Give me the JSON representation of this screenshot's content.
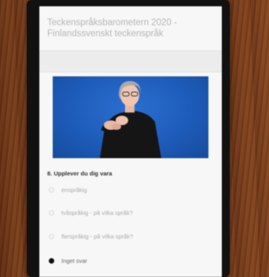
{
  "survey": {
    "title": "Teckenspråksbarometern 2020 - Finlandssvenskt teckenspråk",
    "question": "8. Upplever du dig vara",
    "options": [
      {
        "label": "enspråkig",
        "selected": false
      },
      {
        "label": "tvåspråkig - på vilka språk?",
        "selected": false
      },
      {
        "label": "flerspråkig - på vilka språk?",
        "selected": false
      },
      {
        "label": "Inget svar",
        "selected": true
      }
    ]
  },
  "colors": {
    "video_background": "#1d5ab7",
    "page_background": "#f7f7f7",
    "title_text": "#b6b6b6",
    "wood": "#7a3f1c"
  }
}
